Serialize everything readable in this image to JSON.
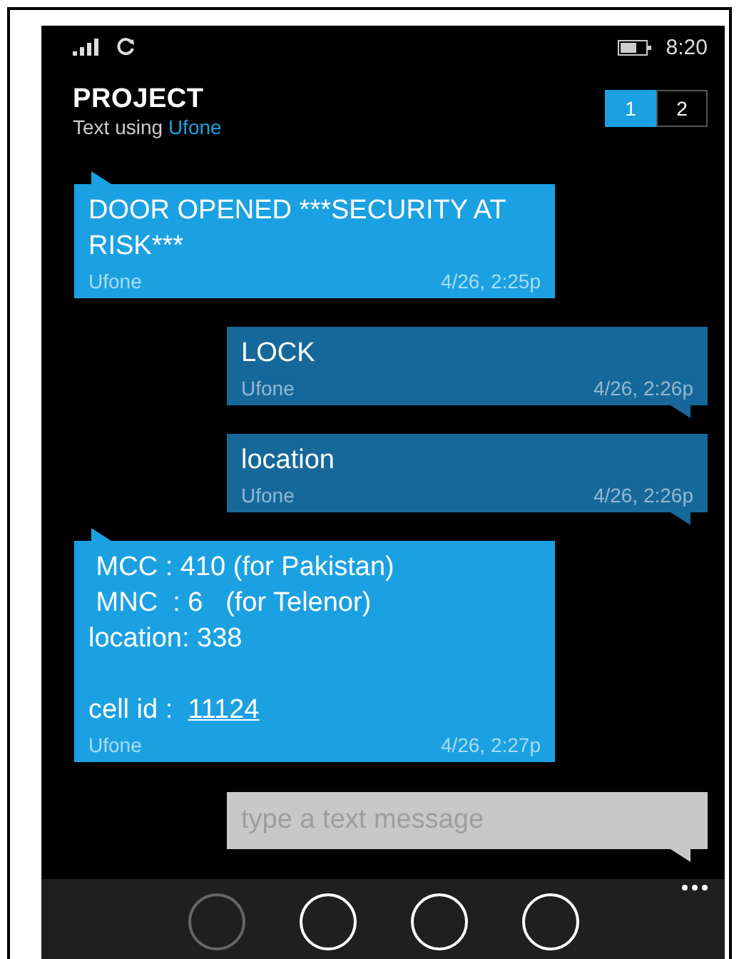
{
  "status_bar": {
    "time": "8:20"
  },
  "header": {
    "title": "PROJECT",
    "subtitle_prefix": "Text using",
    "subtitle_carrier": "Ufone"
  },
  "sim_tabs": [
    {
      "label": "1",
      "selected": true
    },
    {
      "label": "2",
      "selected": false
    }
  ],
  "messages": [
    {
      "kind": "incoming",
      "body": "DOOR OPENED ***SECURITY AT RISK***",
      "sender": "Ufone",
      "time": "4/26, 2:25p"
    },
    {
      "kind": "outgoing",
      "body": "LOCK",
      "sender": "Ufone",
      "time": "4/26, 2:26p"
    },
    {
      "kind": "outgoing",
      "body": "location",
      "sender": "Ufone",
      "time": "4/26, 2:26p"
    },
    {
      "kind": "incoming",
      "body": " MCC : 410 (for Pakistan)\n MNC  : 6   (for Telenor)\nlocation: 338\n\ncell id :  ",
      "link": "11124",
      "sender": "Ufone",
      "time": "4/26, 2:27p"
    }
  ],
  "compose": {
    "placeholder": "type a text message"
  },
  "app_bar": {
    "buttons": [
      {
        "disabled": true
      },
      {
        "disabled": false
      },
      {
        "disabled": false
      },
      {
        "disabled": false
      }
    ]
  }
}
